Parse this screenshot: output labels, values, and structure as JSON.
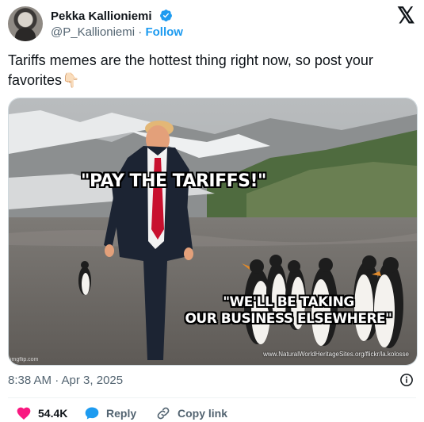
{
  "author": {
    "name": "Pekka Kallioniemi",
    "handle": "@P_Kallioniemi",
    "separator": "·",
    "follow_label": "Follow"
  },
  "tweet": {
    "text": "Tariffs memes are the hottest thing right now, so post your favorites👇🏻"
  },
  "media": {
    "caption_top": "\"PAY THE TARIFFS!\"",
    "caption_bottom_line1": "\"WE'LL BE TAKING",
    "caption_bottom_line2": "OUR BUSINESS ELSEWHERE\"",
    "credit": "www.NaturalWorldHeritageSites.org/flickr/la.kolosse",
    "watermark": "imgflip.com"
  },
  "meta": {
    "timestamp": "8:38 AM · Apr 3, 2025"
  },
  "actions": {
    "like_count": "54.4K",
    "reply_label": "Reply",
    "copy_link_label": "Copy link"
  },
  "colors": {
    "accent": "#1d9bf0",
    "like_red": "#f91880",
    "muted": "#536471"
  },
  "icons": [
    "verified-badge-icon",
    "x-logo-icon",
    "info-icon",
    "heart-icon",
    "reply-bubble-icon",
    "link-icon"
  ]
}
